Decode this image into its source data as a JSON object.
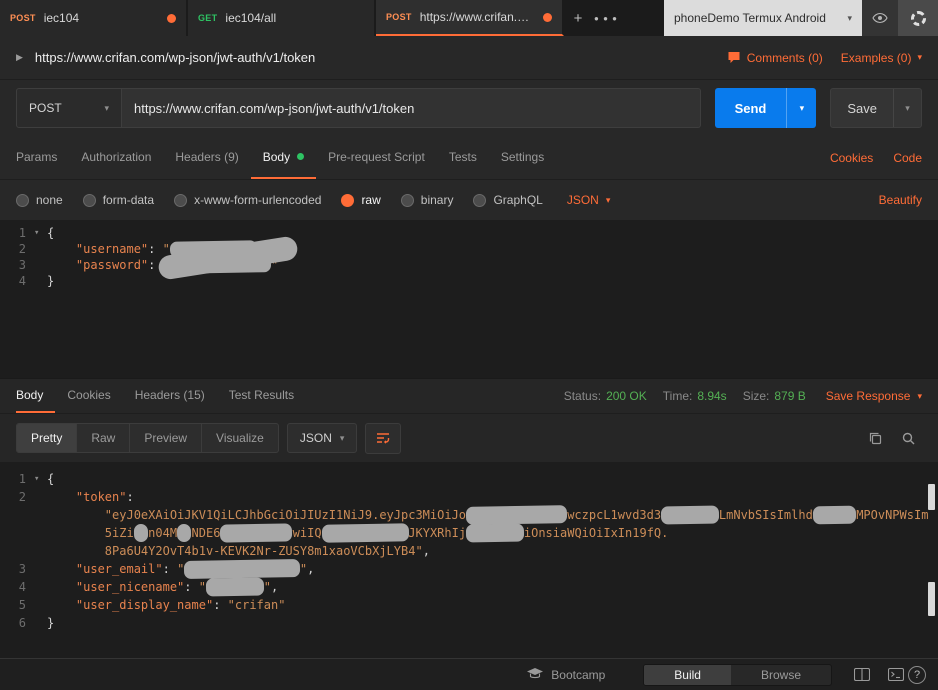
{
  "icons": {
    "chevron_down": "▾",
    "collapse": "▶",
    "plus": "+",
    "more": "● ● ●"
  },
  "colors": {
    "accent_orange": "#ff6c37",
    "send_blue": "#097bed",
    "status_green": "#54b054",
    "get_green": "#2ec363"
  },
  "tab_bar": {
    "tabs": [
      {
        "method": "POST",
        "label": "iec104"
      },
      {
        "method": "GET",
        "label": "iec104/all"
      },
      {
        "method": "POST",
        "label": "https://www.crifan.com..."
      }
    ],
    "environment": "phoneDemo Termux Android"
  },
  "title_row": {
    "title": "https://www.crifan.com/wp-json/jwt-auth/v1/token",
    "comments": "Comments (0)",
    "examples": "Examples (0)"
  },
  "url_row": {
    "method": "POST",
    "url": "https://www.crifan.com/wp-json/jwt-auth/v1/token",
    "send": "Send",
    "save": "Save"
  },
  "request_tabs": {
    "items": [
      "Params",
      "Authorization",
      "Headers (9)",
      "Body",
      "Pre-request Script",
      "Tests",
      "Settings"
    ],
    "cookies": "Cookies",
    "code": "Code"
  },
  "body_modes": {
    "options": [
      "none",
      "form-data",
      "x-www-form-urlencoded",
      "raw",
      "binary",
      "GraphQL"
    ],
    "selected": "raw",
    "format": "JSON",
    "beautify": "Beautify"
  },
  "request_editor": {
    "lines": [
      {
        "no": "1",
        "fold": true,
        "segs": [
          {
            "t": "{",
            "c": "p"
          }
        ]
      },
      {
        "no": "2",
        "segs": [
          {
            "t": "    ",
            "c": "p"
          },
          {
            "t": "\"username\"",
            "c": "k"
          },
          {
            "t": ": ",
            "c": "p"
          },
          {
            "t": "\"",
            "c": "s"
          },
          {
            "t": "            ",
            "c": "r"
          },
          {
            "t": "\"",
            "c": "s"
          },
          {
            "t": ",",
            "c": "p"
          }
        ]
      },
      {
        "no": "3",
        "segs": [
          {
            "t": "    ",
            "c": "p"
          },
          {
            "t": "\"password\"",
            "c": "k"
          },
          {
            "t": ": ",
            "c": "p"
          },
          {
            "t": "\"",
            "c": "s"
          },
          {
            "t": "              ",
            "c": "r"
          },
          {
            "t": "\"",
            "c": "s"
          }
        ]
      },
      {
        "no": "4",
        "segs": [
          {
            "t": "}",
            "c": "p"
          }
        ]
      }
    ]
  },
  "response": {
    "tabs": [
      "Body",
      "Cookies",
      "Headers (15)",
      "Test Results"
    ],
    "meta": [
      {
        "label": "Status:",
        "value": "200 OK"
      },
      {
        "label": "Time:",
        "value": "8.94s"
      },
      {
        "label": "Size:",
        "value": "879 B"
      }
    ],
    "save_response": "Save Response",
    "view_tabs": [
      "Pretty",
      "Raw",
      "Preview",
      "Visualize"
    ],
    "format": "JSON"
  },
  "response_editor": {
    "lines": [
      {
        "no": "1",
        "fold": true,
        "segs": [
          {
            "t": "{",
            "c": "p"
          }
        ]
      },
      {
        "no": "2",
        "segs": [
          {
            "t": "    ",
            "c": "p"
          },
          {
            "t": "\"token\"",
            "c": "k"
          },
          {
            "t": ":",
            "c": "p"
          }
        ]
      },
      {
        "no": "",
        "segs": [
          {
            "t": "        ",
            "c": "p"
          },
          {
            "t": "\"eyJ0eXAiOiJKV1QiLCJhbGciOiJIUzI1NiJ9.eyJpc3MiOiJo",
            "c": "s"
          },
          {
            "t": "              ",
            "c": "r"
          },
          {
            "t": "wczpcL1wvd3d3",
            "c": "s"
          },
          {
            "t": "        ",
            "c": "r"
          },
          {
            "t": "LmNvbSIsImlhd",
            "c": "s"
          },
          {
            "t": "      ",
            "c": "r"
          },
          {
            "t": "MPOvNPWsIm",
            "c": "s"
          }
        ]
      },
      {
        "no": "",
        "segs": [
          {
            "t": "        ",
            "c": "p"
          },
          {
            "t": "5iZi",
            "c": "s"
          },
          {
            "t": "  ",
            "c": "r"
          },
          {
            "t": "n04M",
            "c": "s"
          },
          {
            "t": "  ",
            "c": "r"
          },
          {
            "t": "NDE6",
            "c": "s"
          },
          {
            "t": "          ",
            "c": "r"
          },
          {
            "t": "wiIQ",
            "c": "s"
          },
          {
            "t": "            ",
            "c": "r"
          },
          {
            "t": "JKYXRhIj",
            "c": "s"
          },
          {
            "t": "        ",
            "c": "r"
          },
          {
            "t": "iOnsiaWQiOiIxIn19fQ.",
            "c": "s"
          }
        ]
      },
      {
        "no": "",
        "segs": [
          {
            "t": "        ",
            "c": "p"
          },
          {
            "t": "8Pa6U4Y2OvT4b1v-KEVK2Nr-ZUSY8m1xaoVCbXjLYB4\"",
            "c": "s"
          },
          {
            "t": ",",
            "c": "p"
          }
        ]
      },
      {
        "no": "3",
        "segs": [
          {
            "t": "    ",
            "c": "p"
          },
          {
            "t": "\"user_email\"",
            "c": "k"
          },
          {
            "t": ": ",
            "c": "p"
          },
          {
            "t": "\"",
            "c": "s"
          },
          {
            "t": "                ",
            "c": "r"
          },
          {
            "t": "\"",
            "c": "s"
          },
          {
            "t": ",",
            "c": "p"
          }
        ]
      },
      {
        "no": "4",
        "segs": [
          {
            "t": "    ",
            "c": "p"
          },
          {
            "t": "\"user_nicename\"",
            "c": "k"
          },
          {
            "t": ": ",
            "c": "p"
          },
          {
            "t": "\"",
            "c": "s"
          },
          {
            "t": "        ",
            "c": "r"
          },
          {
            "t": "\"",
            "c": "s"
          },
          {
            "t": ",",
            "c": "p"
          }
        ]
      },
      {
        "no": "5",
        "segs": [
          {
            "t": "    ",
            "c": "p"
          },
          {
            "t": "\"user_display_name\"",
            "c": "k"
          },
          {
            "t": ": ",
            "c": "p"
          },
          {
            "t": "\"crifan\"",
            "c": "s"
          }
        ]
      },
      {
        "no": "6",
        "segs": [
          {
            "t": "}",
            "c": "p"
          }
        ]
      }
    ]
  },
  "footer": {
    "bootcamp": "Bootcamp",
    "build": "Build",
    "browse": "Browse",
    "help": "?"
  }
}
